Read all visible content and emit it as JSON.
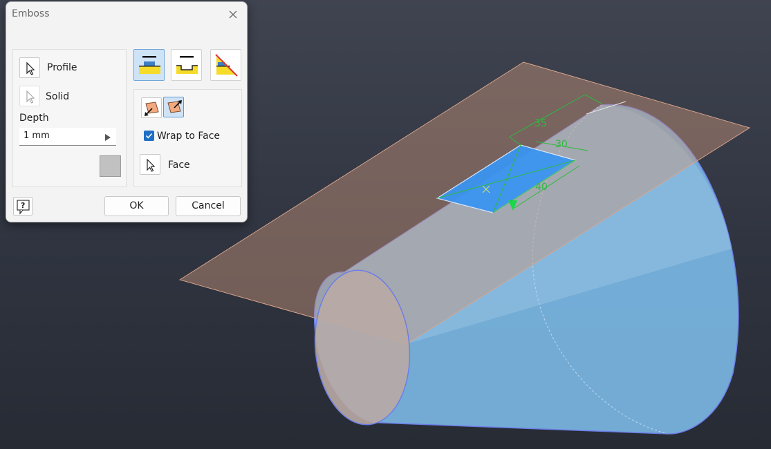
{
  "dialog": {
    "title": "Emboss",
    "profile_label": "Profile",
    "solid_label": "Solid",
    "depth_label": "Depth",
    "depth_value": "1 mm",
    "wrap_to_face_label": "Wrap to Face",
    "wrap_to_face_checked": true,
    "face_label": "Face",
    "ok_label": "OK",
    "cancel_label": "Cancel",
    "tools": [
      "emboss-from-face-icon",
      "engrave-from-face-icon",
      "emboss-engrave-from-plane-icon"
    ],
    "direction_icons": [
      "direction-left-icon",
      "direction-right-icon"
    ]
  },
  "viewport": {
    "dimensions": [
      "35",
      "30",
      "40"
    ]
  },
  "colors": {
    "accent_blue": "#1f6fc5",
    "selection_blue": "#cfe3f7",
    "dimension_green": "#2dbb3f",
    "sketch_plane": "#c9957a",
    "solid_body": "#7ab6e3",
    "background_dark": "#2f3440"
  }
}
